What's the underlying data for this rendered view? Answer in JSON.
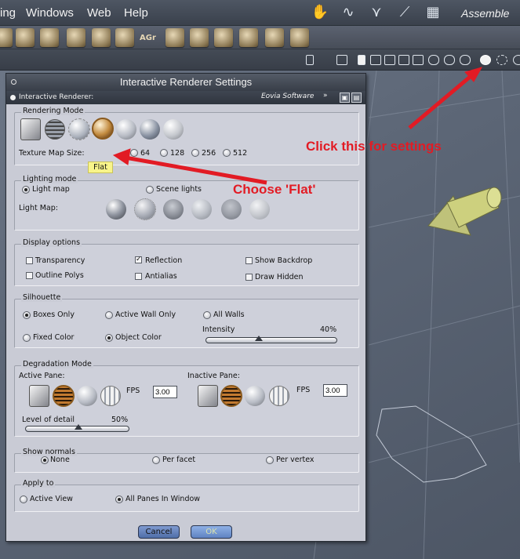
{
  "menubar": {
    "items": [
      "ing",
      "Windows",
      "Web",
      "Help"
    ],
    "room_label": "Assemble"
  },
  "toolbar": {
    "agr_label": "AGr"
  },
  "dialog": {
    "title": "Interactive Renderer Settings",
    "subbar_label": "Interactive Renderer:",
    "preset_value": "Eovia Software",
    "rendering_mode": {
      "title": "Rendering Mode",
      "texture_label": "Texture Map Size:",
      "texture_options": [
        "64",
        "128",
        "256",
        "512"
      ],
      "tooltip": "Flat"
    },
    "lighting_mode": {
      "title": "Lighting mode",
      "light_map_radio": "Light map",
      "scene_lights_radio": "Scene lights",
      "light_map_label": "Light Map:"
    },
    "display_options": {
      "title": "Display options",
      "transparency": "Transparency",
      "reflection": "Reflection",
      "show_backdrop": "Show Backdrop",
      "outline_polys": "Outline Polys",
      "antialias": "Antialias",
      "draw_hidden": "Draw Hidden"
    },
    "silhouette": {
      "title": "Silhouette",
      "boxes_only": "Boxes Only",
      "active_wall_only": "Active Wall Only",
      "all_walls": "All Walls",
      "fixed_color": "Fixed Color",
      "object_color": "Object Color",
      "intensity_label": "Intensity",
      "intensity_value": "40%",
      "intensity_fraction": 0.4
    },
    "degradation": {
      "title": "Degradation Mode",
      "active_pane": "Active Pane:",
      "inactive_pane": "Inactive Pane:",
      "fps_label": "FPS",
      "active_fps": "3.00",
      "inactive_fps": "3.00",
      "level_label": "Level of detail",
      "level_value": "50%",
      "level_fraction": 0.5
    },
    "show_normals": {
      "title": "Show normals",
      "none": "None",
      "per_facet": "Per facet",
      "per_vertex": "Per vertex"
    },
    "apply_to": {
      "title": "Apply to",
      "active_view": "Active View",
      "all_panes": "All Panes In Window"
    },
    "cancel_label": "Cancel",
    "ok_label": "OK"
  },
  "annotations": {
    "settings_hint": "Click this for settings",
    "flat_hint": "Choose 'Flat'"
  },
  "colors": {
    "annotation_red": "#e21b24",
    "dialog_bg": "#c9cbd5",
    "tooltip_yellow": "#f8f48a",
    "cancel_blue": "#4f6ea8",
    "ok_blue": "#5f83c2"
  }
}
